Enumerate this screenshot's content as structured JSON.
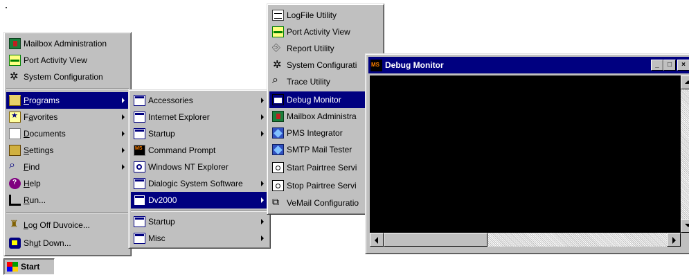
{
  "start_menu": {
    "top_items": [
      {
        "label": "Mailbox Administration",
        "icon": "mailbox-icon"
      },
      {
        "label": "Port Activity View",
        "icon": "port-activity-icon"
      },
      {
        "label": "System Configuration",
        "icon": "system-config-icon"
      }
    ],
    "items": [
      {
        "label": "Programs",
        "accel": "P",
        "rest": "rograms",
        "icon": "programs-folder-icon",
        "submenu": true,
        "selected": true
      },
      {
        "label": "Favorites",
        "accel": "a",
        "pre": "F",
        "rest": "vorites",
        "icon": "favorites-icon",
        "submenu": true
      },
      {
        "label": "Documents",
        "accel": "D",
        "rest": "ocuments",
        "icon": "documents-icon",
        "submenu": true
      },
      {
        "label": "Settings",
        "accel": "S",
        "rest": "ettings",
        "icon": "settings-icon",
        "submenu": true
      },
      {
        "label": "Find",
        "accel": "F",
        "rest": "ind",
        "icon": "find-icon",
        "submenu": true
      },
      {
        "label": "Help",
        "accel": "H",
        "rest": "elp",
        "icon": "help-icon"
      },
      {
        "label": "Run...",
        "accel": "R",
        "rest": "un...",
        "icon": "run-icon"
      }
    ],
    "bottom_items": [
      {
        "label": "Log Off Duvoice...",
        "accel": "L",
        "rest": "og Off Duvoice...",
        "icon": "log-off-icon"
      },
      {
        "label": "Shut Down...",
        "pre": "Sh",
        "accel": "u",
        "rest": "t Down...",
        "icon": "shut-down-icon"
      }
    ]
  },
  "programs_menu": {
    "items": [
      {
        "label": "Accessories",
        "icon": "program-group-icon",
        "submenu": true
      },
      {
        "label": "Internet Explorer",
        "icon": "program-group-icon",
        "submenu": true
      },
      {
        "label": "Startup",
        "icon": "program-group-icon",
        "submenu": true
      },
      {
        "label": "Command Prompt",
        "icon": "command-prompt-icon"
      },
      {
        "label": "Windows NT Explorer",
        "icon": "explorer-icon"
      },
      {
        "label": "Dialogic System Software",
        "icon": "program-group-icon",
        "submenu": true
      },
      {
        "label": "Dv2000",
        "icon": "program-group-icon",
        "submenu": true,
        "selected": true
      },
      {
        "label": "Startup",
        "icon": "program-group-icon",
        "submenu": true
      },
      {
        "label": "Misc",
        "icon": "program-group-icon",
        "submenu": true
      }
    ]
  },
  "dv2000_menu": {
    "items": [
      {
        "label": "LogFile Utility",
        "icon": "logfile-icon"
      },
      {
        "label": "Port Activity View",
        "icon": "port-activity-icon"
      },
      {
        "label": "Report Utility",
        "icon": "report-icon"
      },
      {
        "label": "System Configurati",
        "icon": "system-config-icon"
      },
      {
        "label": "Trace Utility",
        "icon": "trace-icon"
      },
      {
        "label": "Debug Monitor",
        "icon": "debug-monitor-icon",
        "selected": true
      },
      {
        "label": "Mailbox Administra",
        "icon": "mailbox-icon"
      },
      {
        "label": "PMS Integrator",
        "icon": "pms-icon"
      },
      {
        "label": "SMTP Mail Tester",
        "icon": "smtp-icon"
      },
      {
        "label": "Start Pairtree Servi",
        "icon": "service-icon"
      },
      {
        "label": "Stop Pairtree Servi",
        "icon": "service-icon"
      },
      {
        "label": "VeMail Configuratio",
        "icon": "vemail-icon"
      }
    ]
  },
  "debug_window": {
    "title": "Debug Monitor",
    "minimize": "_",
    "maximize": "□",
    "close": "×"
  },
  "taskbar": {
    "start_label": "Start"
  }
}
